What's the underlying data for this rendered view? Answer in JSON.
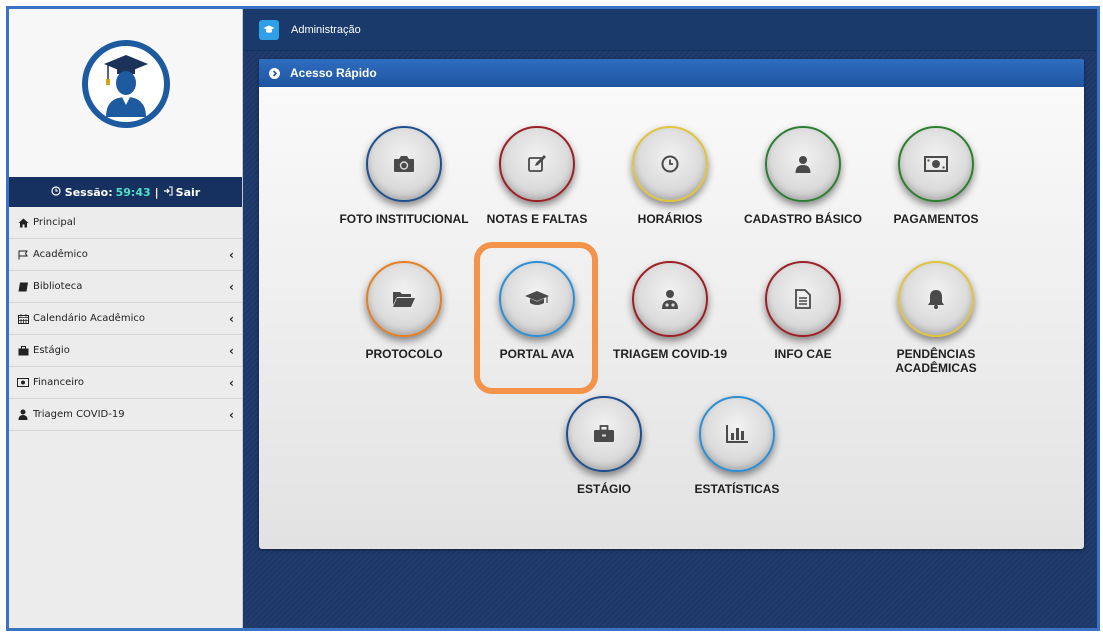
{
  "header": {
    "title": "Administração"
  },
  "session": {
    "label": "Sessão:",
    "time": "59:43",
    "separator": "|",
    "logout": "Sair"
  },
  "sidebar": {
    "items": [
      {
        "label": "Principal",
        "icon": "home-icon",
        "has_submenu": false
      },
      {
        "label": "Acadêmico",
        "icon": "flag-icon",
        "has_submenu": true
      },
      {
        "label": "Biblioteca",
        "icon": "book-icon",
        "has_submenu": true
      },
      {
        "label": "Calendário Acadêmico",
        "icon": "calendar-icon",
        "has_submenu": true
      },
      {
        "label": "Estágio",
        "icon": "briefcase-icon",
        "has_submenu": true
      },
      {
        "label": "Financeiro",
        "icon": "money-icon",
        "has_submenu": true
      },
      {
        "label": "Triagem COVID-19",
        "icon": "user-doctor-icon",
        "has_submenu": true
      }
    ],
    "chevron": "‹"
  },
  "panel": {
    "title": "Acesso Rápido",
    "tiles": [
      {
        "label": "FOTO INSTITUCIONAL",
        "icon": "camera-icon",
        "border": "#1e4f8c"
      },
      {
        "label": "NOTAS E FALTAS",
        "icon": "edit-icon",
        "border": "#9c1f25"
      },
      {
        "label": "HORÁRIOS",
        "icon": "clock-icon",
        "border": "#e0c43b"
      },
      {
        "label": "CADASTRO BÁSICO",
        "icon": "user-icon",
        "border": "#2e7d32"
      },
      {
        "label": "PAGAMENTOS",
        "icon": "money-icon",
        "border": "#2e7d32"
      },
      {
        "label": "PROTOCOLO",
        "icon": "folder-open-icon",
        "border": "#e67e22"
      },
      {
        "label": "PORTAL AVA",
        "icon": "graduation-cap-icon",
        "border": "#2b8fd6"
      },
      {
        "label": "TRIAGEM COVID-19",
        "icon": "user-doctor-icon",
        "border": "#9c1f25"
      },
      {
        "label": "INFO CAE",
        "icon": "file-text-icon",
        "border": "#9c1f25"
      },
      {
        "label": "PENDÊNCIAS ACADÊMICAS",
        "icon": "bell-icon",
        "border": "#e0c43b"
      },
      {
        "label": "ESTÁGIO",
        "icon": "briefcase-icon",
        "border": "#1e4f8c"
      },
      {
        "label": "ESTATÍSTICAS",
        "icon": "bar-chart-icon",
        "border": "#2b8fd6"
      }
    ]
  },
  "colors": {
    "accent": "#1f55a0",
    "highlight": "#f4934a",
    "session_time": "#4fe0c9"
  }
}
